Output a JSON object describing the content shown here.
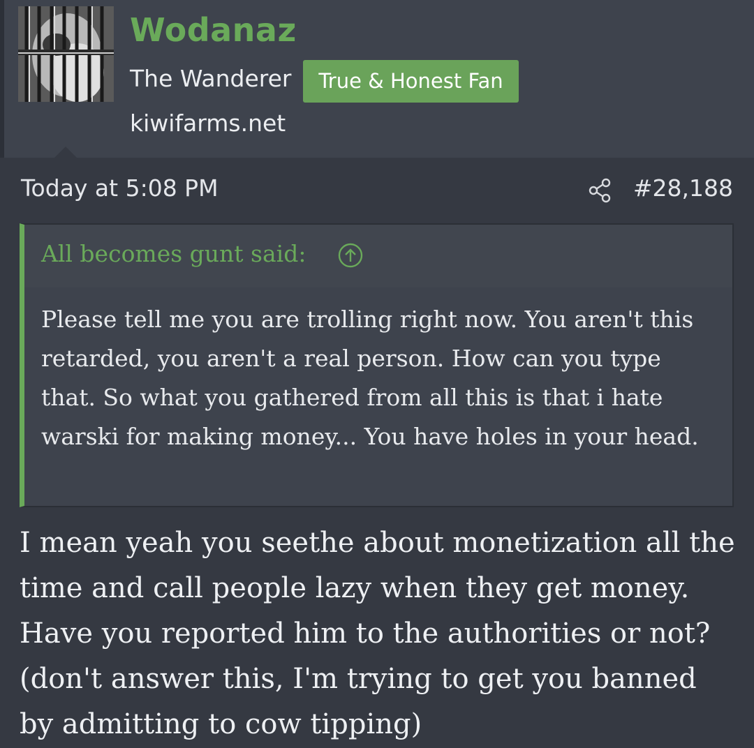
{
  "post": {
    "username": "Wodanaz",
    "user_title": "The Wanderer",
    "badge": "True & Honest Fan",
    "site": "kiwifarms.net",
    "timestamp": "Today at 5:08 PM",
    "post_number": "#28,188",
    "quote": {
      "author": "All becomes gunt said:",
      "text": "Please tell me you are trolling right now. You aren't this retarded, you aren't a real person. How can you type that. So what you gathered from all this is that i hate warski for making money... You have holes in your head."
    },
    "message": "I mean yeah you seethe about monetization all the time and call people lazy when they get money. Have you reported him to the authorities or not? (don't answer this, I'm trying to get you banned by admitting to cow tipping)"
  },
  "icons": {
    "share": "share-icon",
    "quote_jump": "arrow-up-circle-icon",
    "avatar": "avatar-image"
  },
  "colors": {
    "accent_green": "#6aaa5a",
    "badge_green": "#6aa35a",
    "background": "#353942",
    "header_bg": "#3e434d"
  }
}
